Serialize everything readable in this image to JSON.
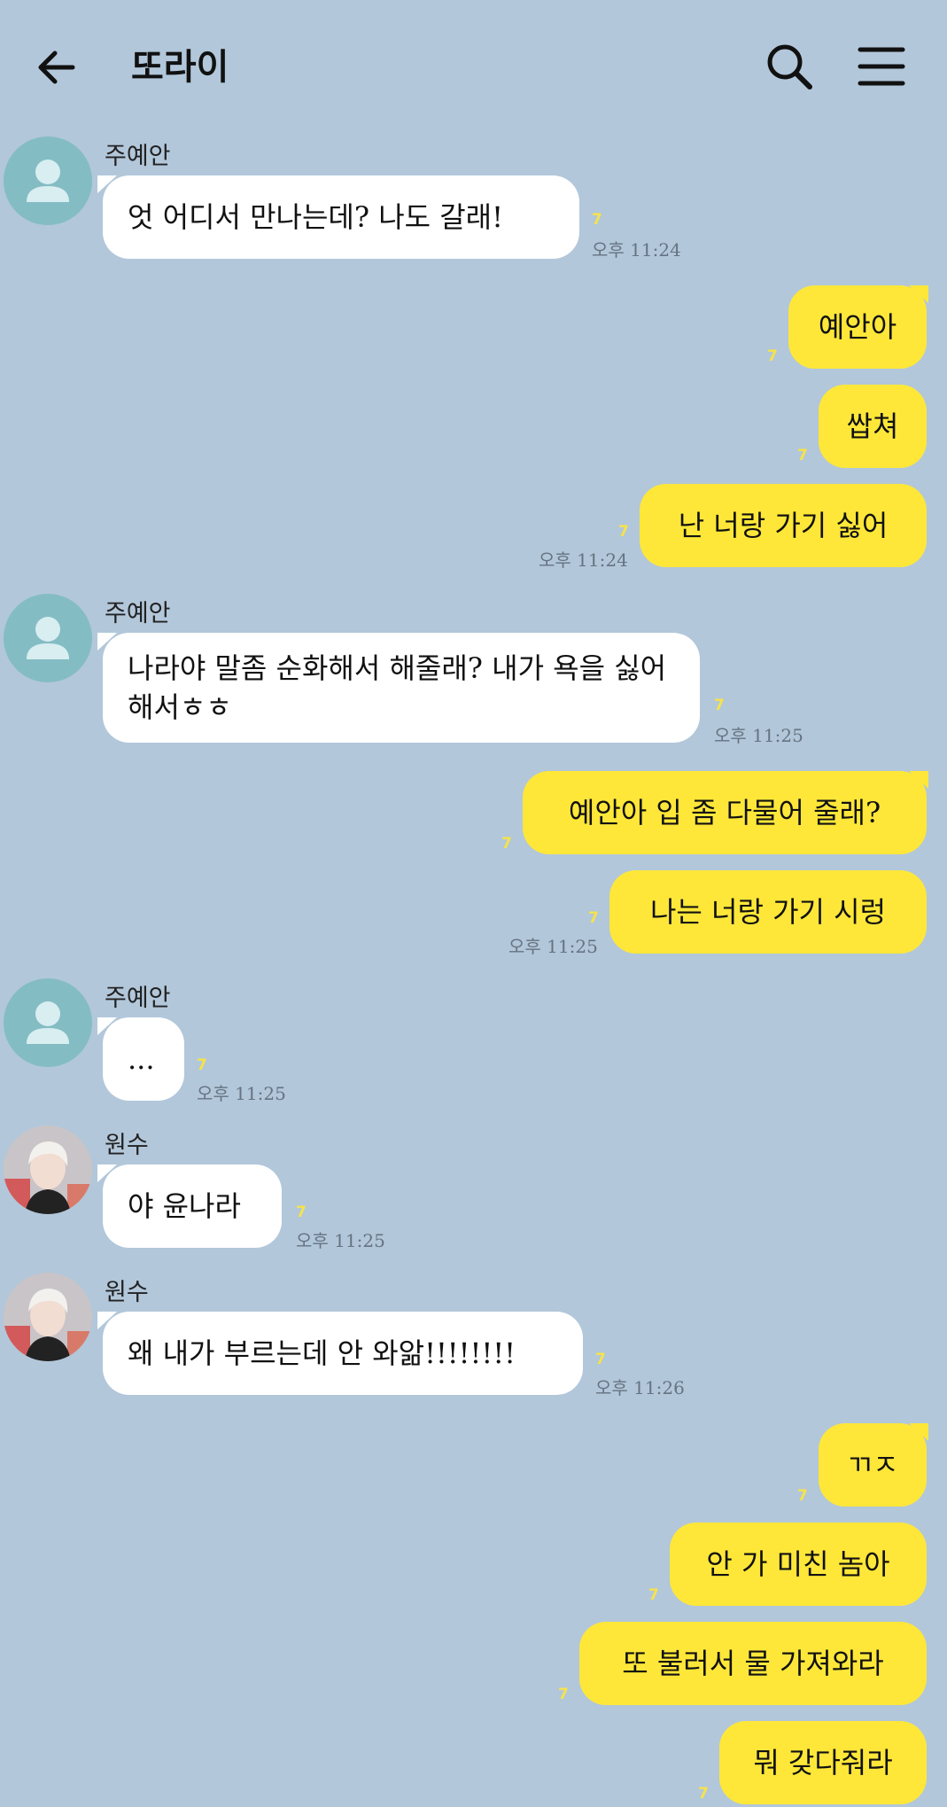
{
  "header": {
    "title": "또라이",
    "back_icon": "arrow-left-icon",
    "search_icon": "search-icon",
    "menu_icon": "hamburger-menu-icon"
  },
  "colors": {
    "background": "#b2c7da",
    "incoming_bubble": "#ffffff",
    "outgoing_bubble": "#fee739",
    "unread_count": "#f6e34a",
    "avatar_default": "#84bcc4"
  },
  "messages": [
    {
      "sender": "주예안",
      "text": "엇 어디서 만나는데? 나도 갈래!",
      "unread": "7",
      "time": "오후 11:24"
    },
    {
      "text": "예안아",
      "unread": "7"
    },
    {
      "text": "쌉쳐",
      "unread": "7"
    },
    {
      "text": "난 너랑 가기 싫어",
      "unread": "7",
      "time": "오후 11:24"
    },
    {
      "sender": "주예안",
      "text": "나라야 말좀 순화해서 해줄래? 내가 욕을 싫어해서ㅎㅎ",
      "unread": "7",
      "time": "오후 11:25"
    },
    {
      "text": "예안아 입 좀 다물어 줄래?",
      "unread": "7"
    },
    {
      "text": "나는 너랑 가기 시렁",
      "unread": "7",
      "time": "오후 11:25"
    },
    {
      "sender": "주예안",
      "text": "...",
      "unread": "7",
      "time": "오후 11:25"
    },
    {
      "sender": "원수",
      "text": "야 윤나라",
      "unread": "7",
      "time": "오후 11:25"
    },
    {
      "sender": "원수",
      "text": "왜 내가 부르는데 안 와앎!!!!!!!!",
      "unread": "7",
      "time": "오후 11:26"
    },
    {
      "text": "ㄲㅈ",
      "unread": "7"
    },
    {
      "text": "안 가 미친 놈아",
      "unread": "7"
    },
    {
      "text": "또 불러서 물 가져와라",
      "unread": "7"
    },
    {
      "text": "뭐 갖다줘라",
      "unread": "7"
    }
  ]
}
